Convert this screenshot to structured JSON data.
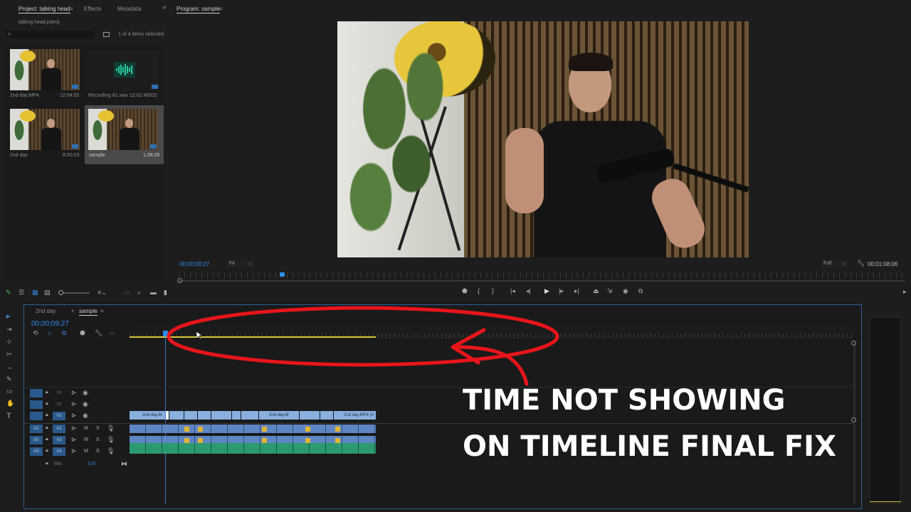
{
  "project_panel": {
    "tabs": [
      {
        "label": "Project: talking head",
        "active": true
      },
      {
        "label": "Effects",
        "active": false
      },
      {
        "label": "Metadata",
        "active": false
      }
    ],
    "expand_glyph": "»",
    "project_file": "talking head.prproj",
    "items_selected": "1 of 4 items selected",
    "items": [
      {
        "name": "2nd day.MP4",
        "duration": "12:04:05",
        "kind": "video"
      },
      {
        "name": "Recording 81.wav",
        "duration": "12:01:40032",
        "kind": "audio"
      },
      {
        "name": "2nd day",
        "duration": "8:50:03",
        "kind": "sequence"
      },
      {
        "name": "sample",
        "duration": "1,08,06",
        "kind": "sequence",
        "selected": true
      }
    ]
  },
  "program_monitor": {
    "title": "Program: sample",
    "timecode": "00;00;09;27",
    "fit_label": "Fit",
    "quality_label": "Full",
    "duration": "00;01;08;06",
    "transport": [
      "marker-icon",
      "in-point-icon",
      "out-point-icon",
      "go-to-in-icon",
      "step-back-icon",
      "play-icon",
      "step-forward-icon",
      "go-to-out-icon",
      "lift-icon",
      "extract-icon",
      "export-frame-icon",
      "compare-icon"
    ],
    "transport_glyphs": [
      "⬟",
      "{",
      "}",
      "|◂",
      "◂|",
      "▶",
      "|▸",
      "▸|",
      "⏏",
      "⇲",
      "◉",
      "⧉"
    ]
  },
  "timeline": {
    "tabs": [
      {
        "label": "2nd day",
        "active": false
      },
      {
        "label": "sample",
        "active": true
      }
    ],
    "close_glyph": "×",
    "timecode": "00;00;09;27",
    "video_tracks": [
      "V3",
      "V2",
      "V1"
    ],
    "audio_tracks": [
      "A1",
      "A2",
      "A3"
    ],
    "mix_label": "Mix",
    "mix_value": "0.0",
    "mute_label": "M",
    "solo_label": "S",
    "clip_labels": [
      "2nd day.M",
      "2nd day.M",
      "2nd day.MP4 [V"
    ]
  },
  "overlay": {
    "line1": "TIME NOT SHOWING",
    "line2": "ON TIMELINE FINAL FIX",
    "annotation_color": "#e8151b"
  },
  "tools": [
    "selection-tool-icon",
    "track-select-icon",
    "ripple-edit-icon",
    "razor-tool-icon",
    "slip-tool-icon",
    "pen-tool-icon",
    "rectangle-tool-icon",
    "hand-tool-icon",
    "type-tool-icon"
  ],
  "tool_glyphs": [
    "▸",
    "⇥",
    "⊹",
    "✂",
    "↔",
    "✎",
    "▭",
    "✋",
    "T"
  ],
  "colors": {
    "accent": "#2d8ceb",
    "playhead": "#3a78c0",
    "work_area": "#d9c93a",
    "video_clip": "#8ab0e0",
    "audio_clip": "#5f86c4",
    "audio_clip_green": "#2c9a70"
  }
}
